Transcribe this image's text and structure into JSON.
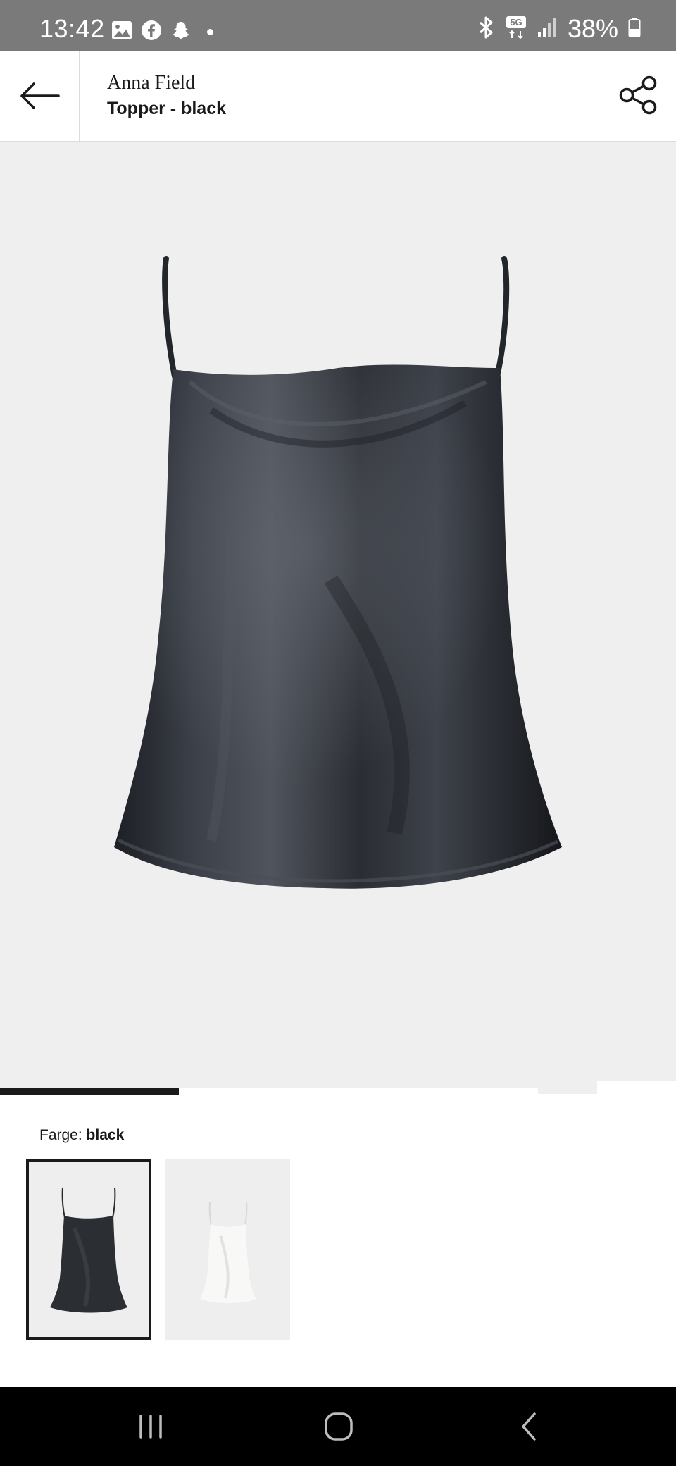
{
  "status_bar": {
    "time": "13:42",
    "battery": "38%",
    "network": "5G",
    "icons_left": [
      "gallery-icon",
      "facebook-icon",
      "snapchat-icon",
      "dot-icon"
    ],
    "icons_right": [
      "bluetooth-icon",
      "5g-icon",
      "signal-icon",
      "battery-icon"
    ]
  },
  "header": {
    "brand": "Anna Field",
    "title": "Topper - black"
  },
  "gallery": {
    "image_description_icon": "product-image",
    "progress_fraction": 0.333
  },
  "color": {
    "label": "Farge:",
    "value": "black",
    "swatches": [
      {
        "name": "black",
        "selected": true,
        "fill": "#2b2e33"
      },
      {
        "name": "white",
        "selected": false,
        "fill": "#f6f6f4"
      }
    ]
  },
  "colors": {
    "status_bar_bg": "#7a7a7a",
    "image_bg": "#efefef",
    "dark": "#1a1a1a",
    "nav_bg": "#000000"
  }
}
